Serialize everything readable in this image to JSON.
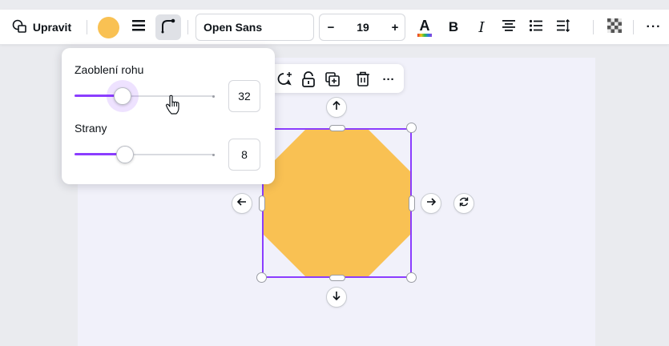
{
  "toolbar": {
    "edit_label": "Upravit",
    "fill_color": "#f9c153",
    "font_name": "Open Sans",
    "font_size_minus": "−",
    "font_size": "19",
    "font_size_plus": "+",
    "text_color_label": "A",
    "bold_label": "B",
    "italic_label": "I",
    "more_label": "···"
  },
  "popover": {
    "corner_label": "Zaoblení rohu",
    "corner_value": "32",
    "corner_fraction": 0.34,
    "sides_label": "Strany",
    "sides_value": "8",
    "sides_fraction": 0.36
  },
  "float_toolbar": {
    "more_label": "···"
  },
  "shape": {
    "type": "octagon",
    "fill": "#f9c153",
    "selection_color": "#8b3dff"
  },
  "colors": {
    "accent": "#8b3dff",
    "canvas": "#eaebef",
    "page": "#f1f1fa"
  }
}
